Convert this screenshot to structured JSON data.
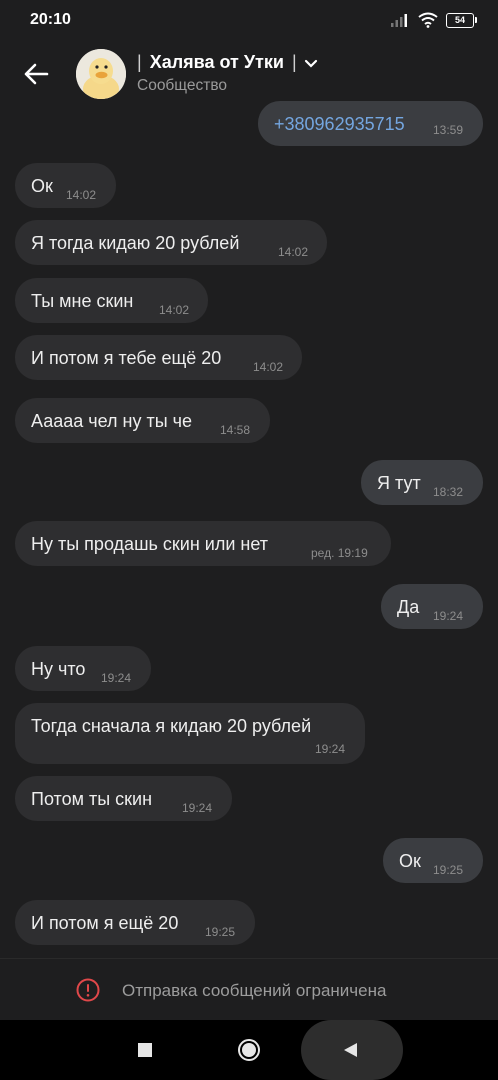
{
  "status": {
    "time": "20:10",
    "battery": "54"
  },
  "header": {
    "title": "Халява от Утки",
    "subtitle": "Сообщество"
  },
  "messages": [
    {
      "text": "+380962935715",
      "time": "13:59",
      "dir": "out"
    },
    {
      "text": "Ок",
      "time": "14:02",
      "dir": "in"
    },
    {
      "text": "Я тогда кидаю 20 рублей",
      "time": "14:02",
      "dir": "in"
    },
    {
      "text": "Ты мне скин",
      "time": "14:02",
      "dir": "in"
    },
    {
      "text": "И потом я тебе ещё 20",
      "time": "14:02",
      "dir": "in"
    },
    {
      "text": "Ааааа чел ну ты че",
      "time": "14:58",
      "dir": "in"
    },
    {
      "text": "Я тут",
      "time": "18:32",
      "dir": "out"
    },
    {
      "text": "Ну ты продашь скин или нет",
      "time": "ред. 19:19",
      "dir": "in"
    },
    {
      "text": "Да",
      "time": "19:24",
      "dir": "out"
    },
    {
      "text": "Ну что",
      "time": "19:24",
      "dir": "in"
    },
    {
      "text": "Тогда сначала я кидаю 20 рублей",
      "time": "19:24",
      "dir": "in"
    },
    {
      "text": "Потом ты скин",
      "time": "19:24",
      "dir": "in"
    },
    {
      "text": "Ок",
      "time": "19:25",
      "dir": "out"
    },
    {
      "text": "И потом я ещё 20",
      "time": "19:25",
      "dir": "in"
    }
  ],
  "footer": {
    "notice": "Отправка сообщений ограничена"
  },
  "colors": {
    "background": "#1e1e1f",
    "bubble_in": "#2e2e30",
    "bubble_out": "#3b3d41",
    "link": "#74a6e0",
    "warning": "#e0484a"
  }
}
